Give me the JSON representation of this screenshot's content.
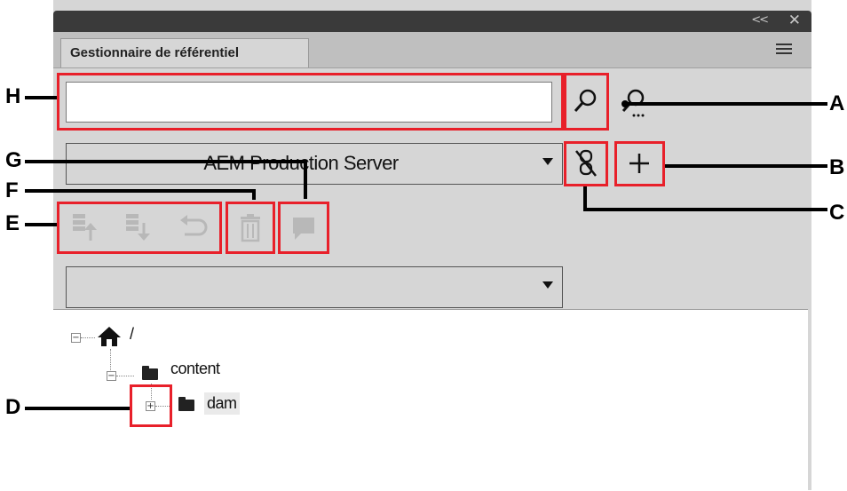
{
  "panel": {
    "title": "Gestionnaire de référentiel",
    "collapse_glyph": "<<",
    "close_glyph": "✕",
    "menu_icon": "hamburger-icon"
  },
  "search": {
    "value": "",
    "placeholder": ""
  },
  "server_dropdown": {
    "selected": "AEM Production Server"
  },
  "path_dropdown": {
    "selected": ""
  },
  "tree": {
    "root": {
      "label": "/",
      "icon": "home-icon"
    },
    "content": {
      "label": "content",
      "icon": "folder-icon"
    },
    "dam": {
      "label": "dam",
      "icon": "folder-icon"
    }
  },
  "callouts": {
    "A": "A",
    "B": "B",
    "C": "C",
    "D": "D",
    "E": "E",
    "F": "F",
    "G": "G",
    "H": "H"
  },
  "colors": {
    "highlight": "#e8202a",
    "panel": "#d6d6d6",
    "titlebar": "#3a3a3a"
  }
}
